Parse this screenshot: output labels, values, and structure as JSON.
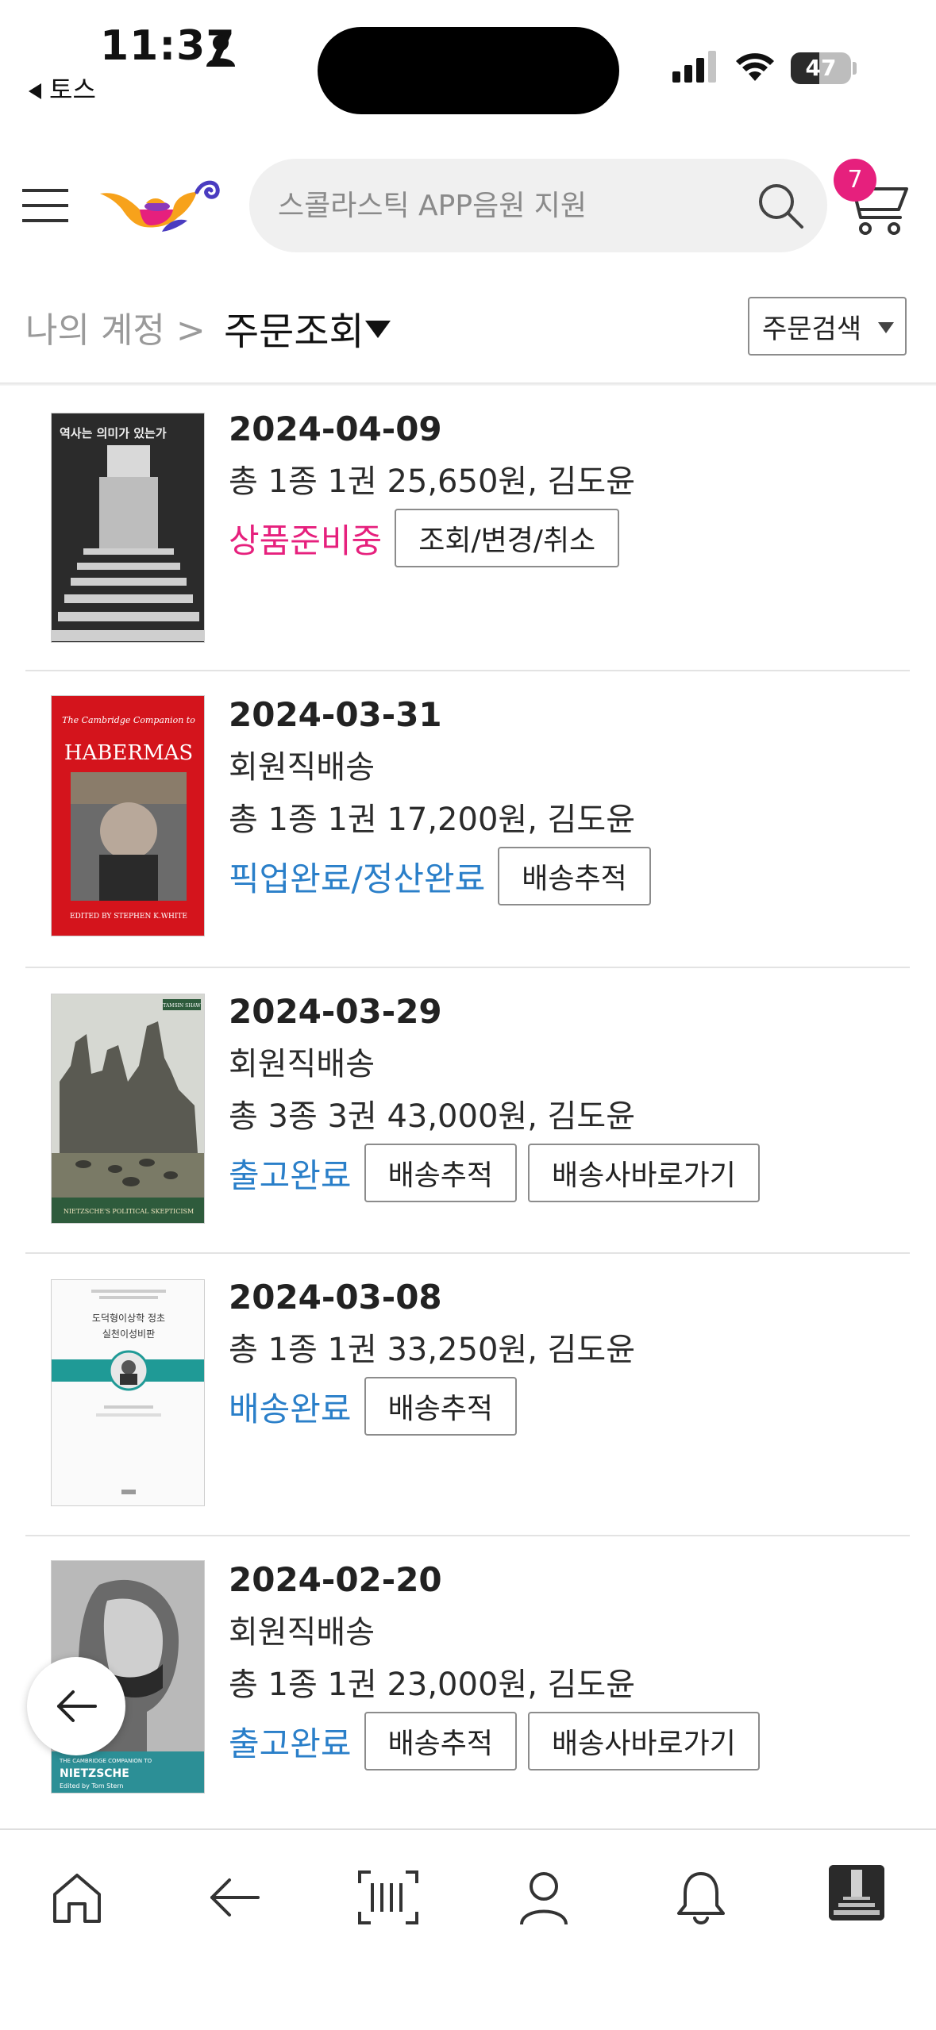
{
  "status_bar": {
    "time": "11:37",
    "back_app": "토스",
    "battery": "47"
  },
  "header": {
    "search_placeholder": "스콜라스틱 APP음원 지원",
    "cart_count": "7"
  },
  "breadcrumb": {
    "parent": "나의 계정 >",
    "current": "주문조회",
    "order_search_label": "주문검색"
  },
  "colors": {
    "accent": "#e6207d",
    "status_blue": "#2a7fc9"
  },
  "orders": [
    {
      "date": "2024-04-09",
      "summary": "총 1종 1권 25,650원, 김도윤",
      "status": "상품준비중",
      "buttons": [
        "조회/변경/취소"
      ],
      "cover_title": "역사는 의미가 있는가"
    },
    {
      "date": "2024-03-31",
      "delivery": "회원직배송",
      "summary": "총 1종 1권 17,200원, 김도윤",
      "status": "픽업완료/정산완료",
      "buttons": [
        "배송추적"
      ],
      "cover_series": "The Cambridge Companion to",
      "cover_title": "HABERMAS",
      "cover_editor": "EDITED BY STEPHEN K.WHITE"
    },
    {
      "date": "2024-03-29",
      "delivery": "회원직배송",
      "summary": "총 3종 3권 43,000원, 김도윤",
      "status": "출고완료",
      "buttons": [
        "배송추적",
        "배송사바로가기"
      ],
      "cover_author": "TAMSIN SHAW",
      "cover_title": "NIETZSCHE'S POLITICAL SKEPTICISM"
    },
    {
      "date": "2024-03-08",
      "summary": "총 1종 1권 33,250원, 김도윤",
      "status": "배송완료",
      "buttons": [
        "배송추적"
      ],
      "cover_title1": "도덕형이상학 정초",
      "cover_title2": "실천이성비판"
    },
    {
      "date": "2024-02-20",
      "delivery": "회원직배송",
      "summary": "총 1종 1권 23,000원, 김도윤",
      "status": "출고완료",
      "buttons": [
        "배송추적",
        "배송사바로가기"
      ],
      "cover_series": "THE CAMBRIDGE COMPANION TO",
      "cover_title": "NIETZSCHE",
      "cover_editor": "Edited by Tom Stern"
    }
  ],
  "bottom_nav": [
    "home-icon",
    "back-arrow-icon",
    "barcode-scan-icon",
    "profile-icon",
    "bell-icon",
    "recent-item-thumbnail"
  ]
}
